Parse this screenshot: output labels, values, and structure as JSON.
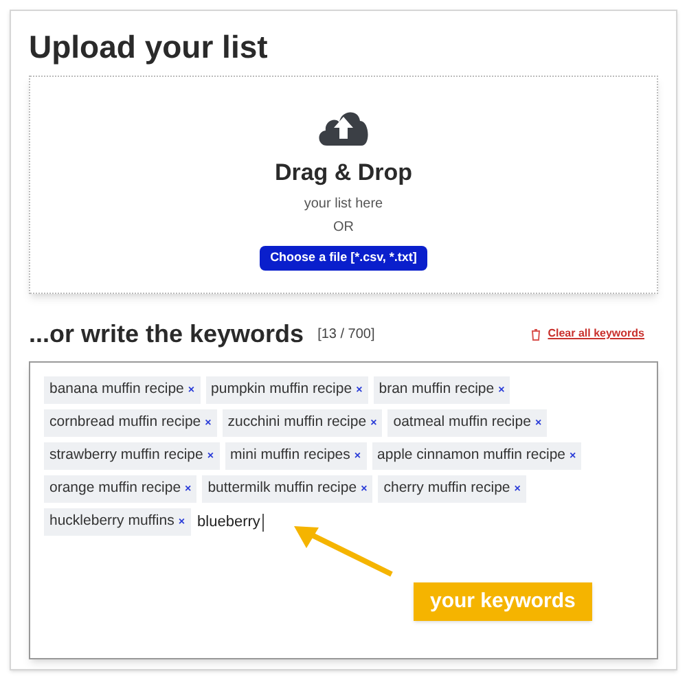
{
  "title": "Upload your list",
  "dropzone": {
    "heading": "Drag & Drop",
    "subtext": "your list here",
    "separator": "OR",
    "button": "Choose a file [*.csv, *.txt]"
  },
  "keywords_section": {
    "heading": "...or write the keywords",
    "count": "[13 / 700]",
    "clear_link": "Clear all keywords"
  },
  "keywords": [
    {
      "label": "banana muffin recipe",
      "remove": "×"
    },
    {
      "label": "pumpkin muffin recipe",
      "remove": "×"
    },
    {
      "label": "bran muffin recipe",
      "remove": "×"
    },
    {
      "label": "cornbread muffin recipe",
      "remove": "×"
    },
    {
      "label": "zucchini muffin recipe",
      "remove": "×"
    },
    {
      "label": "oatmeal muffin recipe",
      "remove": "×"
    },
    {
      "label": "strawberry muffin recipe",
      "remove": "×"
    },
    {
      "label": "mini muffin recipes",
      "remove": "×"
    },
    {
      "label": "apple cinnamon muffin recipe",
      "remove": "×"
    },
    {
      "label": "orange muffin recipe",
      "remove": "×"
    },
    {
      "label": "buttermilk muffin recipe",
      "remove": "×"
    },
    {
      "label": "cherry muffin recipe",
      "remove": "×"
    },
    {
      "label": "huckleberry muffins",
      "remove": "×"
    }
  ],
  "keyword_input": {
    "value": "blueberry"
  },
  "annotation": {
    "label": "your keywords"
  }
}
